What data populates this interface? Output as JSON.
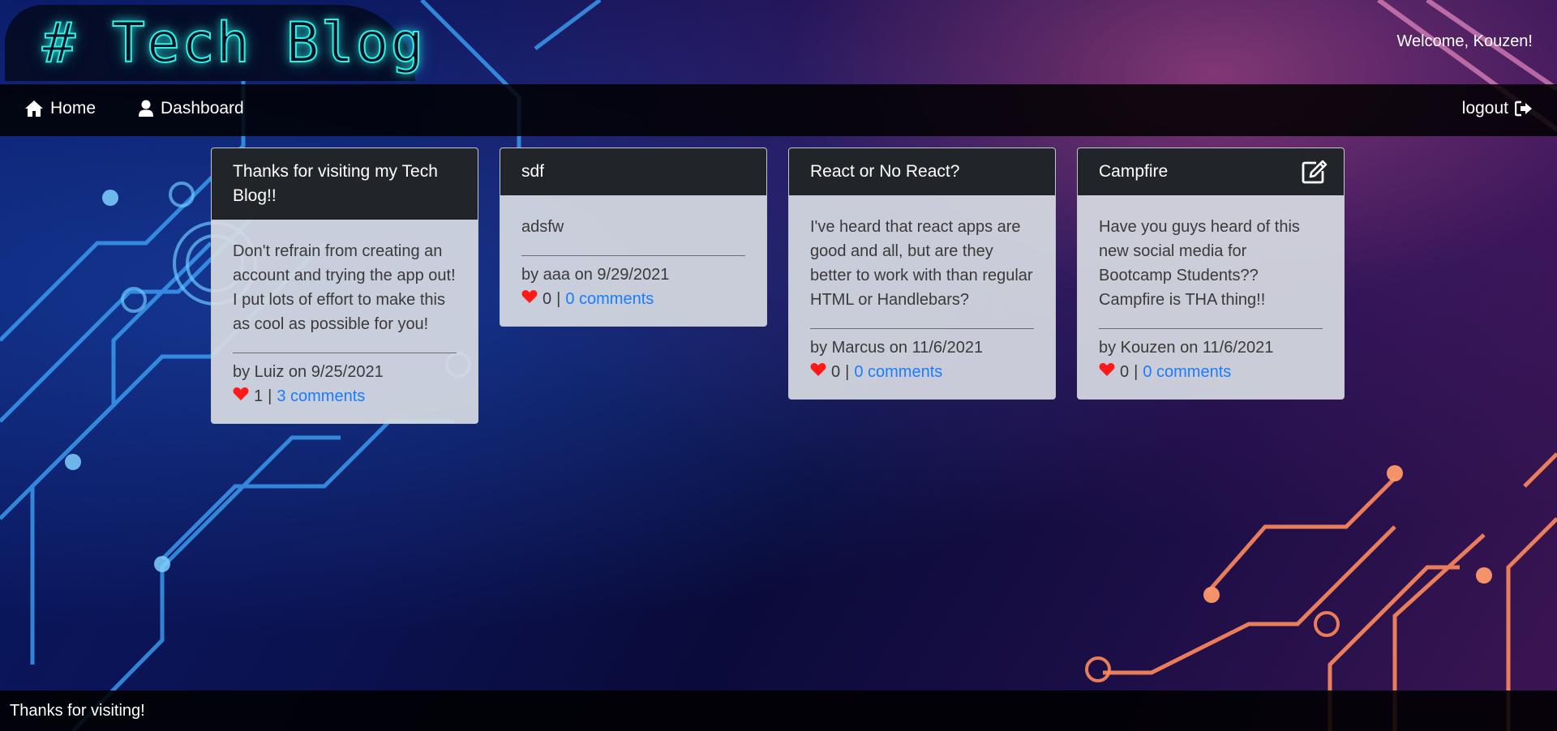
{
  "header": {
    "brand": "# Tech Blog",
    "welcome": "Welcome, Kouzen!"
  },
  "nav": {
    "home_label": "Home",
    "home_icon": "home-icon",
    "dashboard_label": "Dashboard",
    "dashboard_icon": "user-icon",
    "logout_label": "logout",
    "logout_icon": "sign-out-icon"
  },
  "posts": [
    {
      "title": "Thanks for visiting my Tech Blog!!",
      "content": "Don't refrain from creating an account and trying the app out! I put lots of effort to make this as cool as possible for you!",
      "byline": "by Luiz on 9/25/2021",
      "likes": "1",
      "separator": "|",
      "comments": "3 comments",
      "editable": false
    },
    {
      "title": "sdf",
      "content": "adsfw",
      "byline": "by aaa on 9/29/2021",
      "likes": "0",
      "separator": "|",
      "comments": "0 comments",
      "editable": false
    },
    {
      "title": "React or No React?",
      "content": "I've heard that react apps are good and all, but are they better to work with than regular HTML or Handlebars?",
      "byline": "by Marcus on 11/6/2021",
      "likes": "0",
      "separator": "|",
      "comments": "0 comments",
      "editable": false
    },
    {
      "title": "Campfire",
      "content": "Have you guys heard of this new social media for Bootcamp Students?? Campfire is THA thing!!",
      "byline": "by Kouzen on 11/6/2021",
      "likes": "0",
      "separator": "|",
      "comments": "0 comments",
      "editable": true
    }
  ],
  "footer": {
    "text": "Thanks for visiting!"
  },
  "colors": {
    "brand_neon": "#2ef0e8",
    "card_header": "#212529",
    "card_body": "#d6dae2",
    "link": "#1a7cff",
    "heart": "#ff1a1a"
  }
}
